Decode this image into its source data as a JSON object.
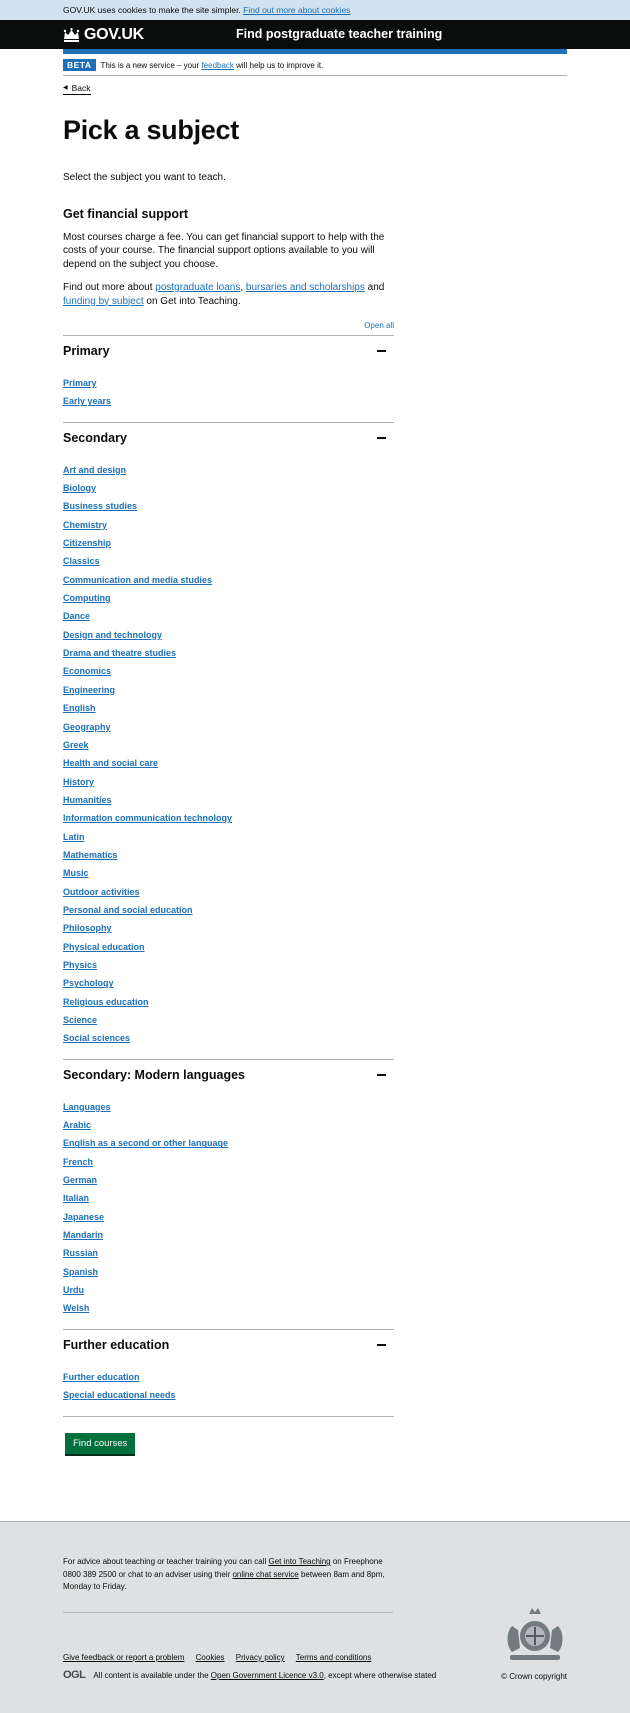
{
  "cookie": {
    "text": "GOV.UK uses cookies to make the site simpler.",
    "link": "Find out more about cookies"
  },
  "header": {
    "logo": "GOV.UK",
    "service": "Find postgraduate teacher training"
  },
  "phase": {
    "tag": "BETA",
    "text_before": "This is a new service – your",
    "link": "feedback",
    "text_after": "will help us to improve it."
  },
  "back_link": "Back",
  "page": {
    "title": "Pick a subject",
    "lead": "Select the subject you want to teach.",
    "fin_heading": "Get financial support",
    "fin_para": "Most courses charge a fee. You can get financial support to help with the costs of your course. The financial support options available to you will depend on the subject you choose.",
    "more_prefix": "Find out more about",
    "link_loans": "postgraduate loans",
    "comma": ",",
    "link_bursaries": "bursaries and scholarships",
    "and": "and",
    "link_funding": "funding by subject",
    "more_suffix": "on Get into Teaching."
  },
  "accordion": {
    "open_all": "Open all",
    "sections": [
      {
        "title": "Primary",
        "items": [
          "Primary",
          "Early years"
        ]
      },
      {
        "title": "Secondary",
        "items": [
          "Art and design",
          "Biology",
          "Business studies",
          "Chemistry",
          "Citizenship",
          "Classics",
          "Communication and media studies",
          "Computing",
          "Dance",
          "Design and technology",
          "Drama and theatre studies",
          "Economics",
          "Engineering",
          "English",
          "Geography",
          "Greek",
          "Health and social care",
          "History",
          "Humanities",
          "Information communication technology",
          "Latin",
          "Mathematics",
          "Music",
          "Outdoor activities",
          "Personal and social education",
          "Philosophy",
          "Physical education",
          "Physics",
          "Psychology",
          "Religious education",
          "Science",
          "Social sciences"
        ]
      },
      {
        "title": "Secondary: Modern languages",
        "items": [
          "Languages",
          "Arabic",
          "English as a second or other language",
          "French",
          "German",
          "Italian",
          "Japanese",
          "Mandarin",
          "Russian",
          "Spanish",
          "Urdu",
          "Welsh"
        ]
      },
      {
        "title": "Further education",
        "items": [
          "Further education",
          "Special educational needs"
        ]
      }
    ]
  },
  "button": "Find courses",
  "footer": {
    "advice_1": "For advice about teaching or teacher training you can call",
    "advice_link1": "Get into Teaching",
    "advice_2": "on Freephone 0800 389 2500 or chat to an adviser using their",
    "advice_link2": "online chat service",
    "advice_3": "between 8am and 8pm, Monday to Friday.",
    "links": [
      "Give feedback or report a problem",
      "Cookies",
      "Privacy policy",
      "Terms and conditions"
    ],
    "ogl": "OGL",
    "licence_prefix": "All content is available under the",
    "licence_link": "Open Government Licence v3.0",
    "licence_suffix": ", except where otherwise stated",
    "copyright": "© Crown copyright"
  }
}
